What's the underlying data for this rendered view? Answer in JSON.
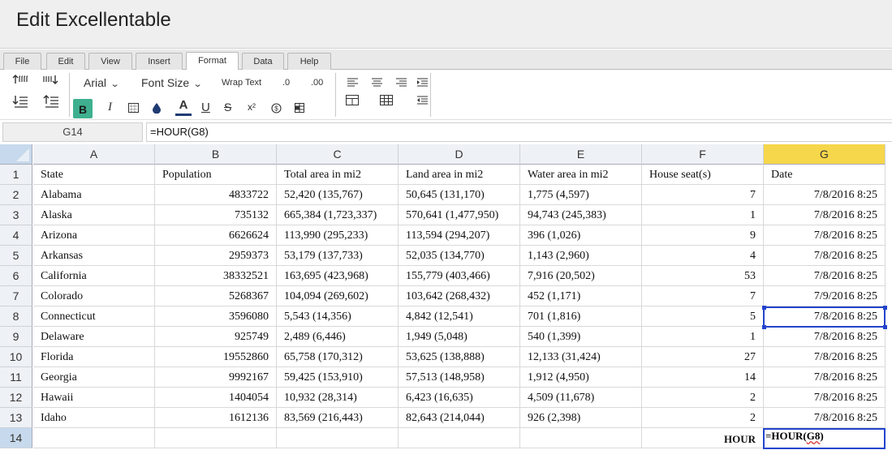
{
  "app": {
    "title": "Edit Excellentable"
  },
  "menu": {
    "tabs": [
      "File",
      "Edit",
      "View",
      "Insert",
      "Format",
      "Data",
      "Help"
    ],
    "active": "Format"
  },
  "toolbar": {
    "font": "Arial",
    "font_size": "Font Size",
    "wrap_text": "Wrap Text",
    "decrease_decimal": ".0",
    "increase_decimal": ".00",
    "bold": "B",
    "italic": "I",
    "text_color": "A",
    "underline": "U",
    "strike": "S",
    "superscript": "x²",
    "bold_active_color": "#3eb08f"
  },
  "formula_bar": {
    "cell_ref": "G14",
    "formula": "=HOUR(G8)"
  },
  "sheet": {
    "columns": [
      "A",
      "B",
      "C",
      "D",
      "E",
      "F",
      "G"
    ],
    "selected_column": "G",
    "rows": [
      [
        "State",
        "Population",
        "Total area in mi2",
        "Land area in mi2",
        "Water area in mi2",
        "House seat(s)",
        "Date"
      ],
      [
        "Alabama",
        "4833722",
        "52,420 (135,767)",
        "50,645 (131,170)",
        "1,775 (4,597)",
        "7",
        "7/8/2016 8:25"
      ],
      [
        "Alaska",
        "735132",
        "665,384 (1,723,337)",
        "570,641 (1,477,950)",
        "94,743 (245,383)",
        "1",
        "7/8/2016 8:25"
      ],
      [
        "Arizona",
        "6626624",
        "113,990 (295,233)",
        "113,594 (294,207)",
        "396 (1,026)",
        "9",
        "7/8/2016 8:25"
      ],
      [
        "Arkansas",
        "2959373",
        "53,179 (137,733)",
        "52,035 (134,770)",
        "1,143 (2,960)",
        "4",
        "7/8/2016 8:25"
      ],
      [
        "California",
        "38332521",
        "163,695 (423,968)",
        "155,779 (403,466)",
        "7,916 (20,502)",
        "53",
        "7/8/2016 8:25"
      ],
      [
        "Colorado",
        "5268367",
        "104,094 (269,602)",
        "103,642 (268,432)",
        "452 (1,171)",
        "7",
        "7/9/2016 8:25"
      ],
      [
        "Connecticut",
        "3596080",
        "5,543 (14,356)",
        "4,842 (12,541)",
        "701 (1,816)",
        "5",
        "7/8/2016 8:25"
      ],
      [
        "Delaware",
        "925749",
        "2,489 (6,446)",
        "1,949 (5,048)",
        "540 (1,399)",
        "1",
        "7/8/2016 8:25"
      ],
      [
        "Florida",
        "19552860",
        "65,758 (170,312)",
        "53,625 (138,888)",
        "12,133 (31,424)",
        "27",
        "7/8/2016 8:25"
      ],
      [
        "Georgia",
        "9992167",
        "59,425 (153,910)",
        "57,513 (148,958)",
        "1,912 (4,950)",
        "14",
        "7/8/2016 8:25"
      ],
      [
        "Hawaii",
        "1404054",
        "10,932 (28,314)",
        "6,423 (16,635)",
        "4,509 (11,678)",
        "2",
        "7/8/2016 8:25"
      ],
      [
        "Idaho",
        "1612136",
        "83,569 (216,443)",
        "82,643 (214,044)",
        "926 (2,398)",
        "2",
        "7/8/2016 8:25"
      ],
      [
        "",
        "",
        "",
        "",
        "",
        "HOUR",
        ""
      ]
    ],
    "row_numbers": [
      "1",
      "2",
      "3",
      "4",
      "5",
      "6",
      "7",
      "8",
      "9",
      "10",
      "11",
      "12",
      "13",
      "14"
    ],
    "selected_row": "14",
    "editing_cell": {
      "prefix": "=HOUR(",
      "ref": "G8",
      "suffix": ")"
    }
  }
}
